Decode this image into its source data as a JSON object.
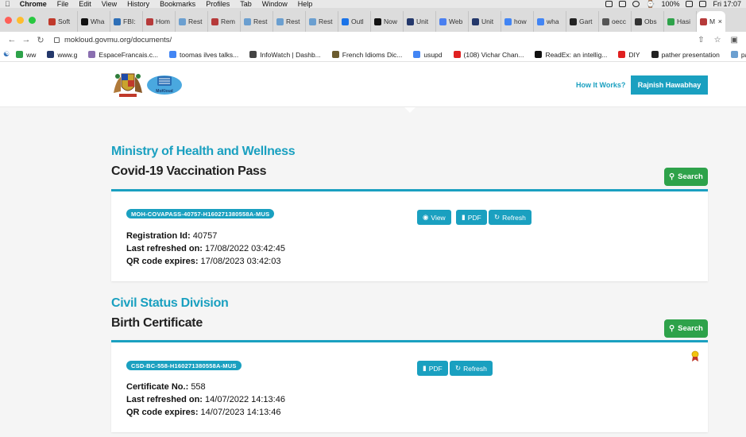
{
  "os_menu": {
    "app": "Chrome",
    "items": [
      "File",
      "Edit",
      "View",
      "History",
      "Bookmarks",
      "Profiles",
      "Tab",
      "Window",
      "Help"
    ],
    "battery": "100%",
    "clock": "Fri 17:07"
  },
  "tabs": [
    {
      "label": "Soft",
      "color": "#c0392b"
    },
    {
      "label": "Wha",
      "color": "#111111"
    },
    {
      "label": "FBI:",
      "color": "#2e6fb7"
    },
    {
      "label": "Hom",
      "color": "#b63a3a"
    },
    {
      "label": "Rest",
      "color": "#6b9fd0"
    },
    {
      "label": "Rem",
      "color": "#b63a3a"
    },
    {
      "label": "Rest",
      "color": "#6b9fd0"
    },
    {
      "label": "Rest",
      "color": "#6b9fd0"
    },
    {
      "label": "Rest",
      "color": "#6b9fd0"
    },
    {
      "label": "Outl",
      "color": "#1a73e8"
    },
    {
      "label": "Now",
      "color": "#111111"
    },
    {
      "label": "Unit",
      "color": "#24386b"
    },
    {
      "label": "Web",
      "color": "#4a7ff0"
    },
    {
      "label": "Unit",
      "color": "#24386b"
    },
    {
      "label": "how",
      "color": "#4285f4"
    },
    {
      "label": "wha",
      "color": "#4285f4"
    },
    {
      "label": "Gart",
      "color": "#222222"
    },
    {
      "label": "oecc",
      "color": "#555555"
    },
    {
      "label": "Obs",
      "color": "#333333"
    },
    {
      "label": "Hasi",
      "color": "#2ea24a"
    },
    {
      "label": "M",
      "color": "#b63a3a",
      "active": true
    }
  ],
  "address_bar": {
    "url": "mokloud.govmu.org/documents/"
  },
  "bookmarks": [
    {
      "label": "ww",
      "color": "#2ea24a"
    },
    {
      "label": "www.g",
      "color": "#24386b"
    },
    {
      "label": "EspaceFrancais.c...",
      "color": "#8a6fb0"
    },
    {
      "label": "toomas ilves talks...",
      "color": "#4285f4"
    },
    {
      "label": "InfoWatch | Dashb...",
      "color": "#444444"
    },
    {
      "label": "French Idioms Dic...",
      "color": "#6b5b2e"
    },
    {
      "label": "usupd",
      "color": "#4285f4"
    },
    {
      "label": "(108) Vichar Chan...",
      "color": "#e02020"
    },
    {
      "label": "ReadEx: an intellig...",
      "color": "#111111"
    },
    {
      "label": "DIY",
      "color": "#e02020"
    },
    {
      "label": "pather presentation",
      "color": "#222222"
    },
    {
      "label": "pather presentation",
      "color": "#6b9fd0"
    }
  ],
  "site_header": {
    "how_it_works": "How It Works?",
    "user_name": "Rajnish Hawabhay",
    "logo_text": "MoKloud"
  },
  "sections": [
    {
      "ministry": "Ministry of Health and Wellness",
      "doc_type": "Covid-19 Vaccination Pass",
      "search_label": "Search",
      "doc_id": "MOH-COVAPASS-40757-H160271380558A-MUS",
      "buttons": {
        "view": "View",
        "pdf": "PDF",
        "refresh": "Refresh"
      },
      "fields": [
        {
          "label": "Registration Id:",
          "value": "40757"
        },
        {
          "label": "Last refreshed on:",
          "value": "17/08/2022 03:42:45"
        },
        {
          "label": "QR code expires:",
          "value": "17/08/2023 03:42:03"
        }
      ]
    },
    {
      "ministry": "Civil Status Division",
      "doc_type": "Birth Certificate",
      "search_label": "Search",
      "doc_id": "CSD-BC-558-H160271380558A-MUS",
      "buttons": {
        "pdf": "PDF",
        "refresh": "Refresh"
      },
      "fields": [
        {
          "label": "Certificate No.:",
          "value": "558"
        },
        {
          "label": "Last refreshed on:",
          "value": "14/07/2022 14:13:46"
        },
        {
          "label": "QR code expires:",
          "value": "14/07/2023 14:13:46"
        }
      ]
    }
  ],
  "colors": {
    "accent": "#1aa0c0",
    "search_green": "#2ea24a",
    "page_bg": "#f5f5f5"
  }
}
